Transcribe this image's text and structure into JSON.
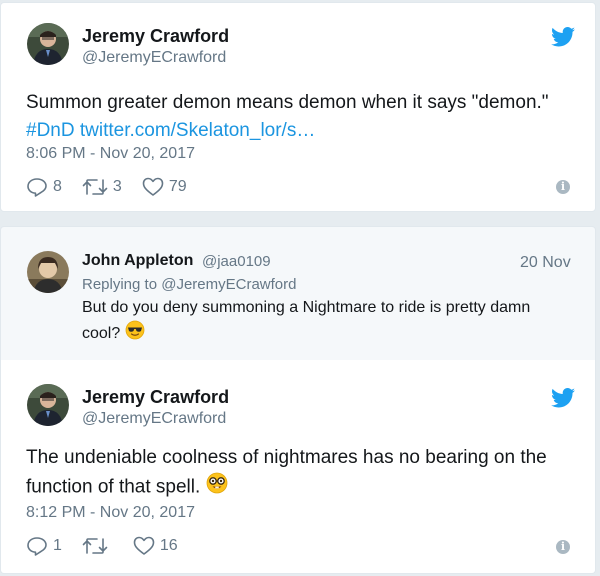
{
  "tweet1": {
    "name": "Jeremy Crawford",
    "handle": "@JeremyECrawford",
    "text": "Summon greater demon means demon when it says \"demon.\"",
    "hashtag": "#DnD",
    "link": "twitter.com/Skelaton_lor/s…",
    "timestamp": "8:06 PM - Nov 20, 2017",
    "replies": "8",
    "retweets": "3",
    "likes": "79"
  },
  "reply": {
    "name": "John Appleton",
    "handle": "@jaa0109",
    "date": "20 Nov",
    "replying_to": "Replying to @JeremyECrawford",
    "text": "But do you deny summoning a Nightmare to ride is pretty damn cool?"
  },
  "tweet2": {
    "name": "Jeremy Crawford",
    "handle": "@JeremyECrawford",
    "text": "The undeniable coolness of nightmares has no bearing on the function of that spell.",
    "timestamp": "8:12 PM - Nov 20, 2017",
    "replies": "1",
    "retweets": "",
    "likes": "16"
  },
  "colors": {
    "link": "#1b95e0",
    "muted": "#657786",
    "twitter_blue": "#1da1f2"
  },
  "icons": {
    "bird": "twitter-bird-icon",
    "reply": "reply-icon",
    "retweet": "retweet-icon",
    "like": "heart-icon",
    "info": "info-icon",
    "sunglasses": "sunglasses-emoji",
    "nerd": "nerd-emoji"
  }
}
